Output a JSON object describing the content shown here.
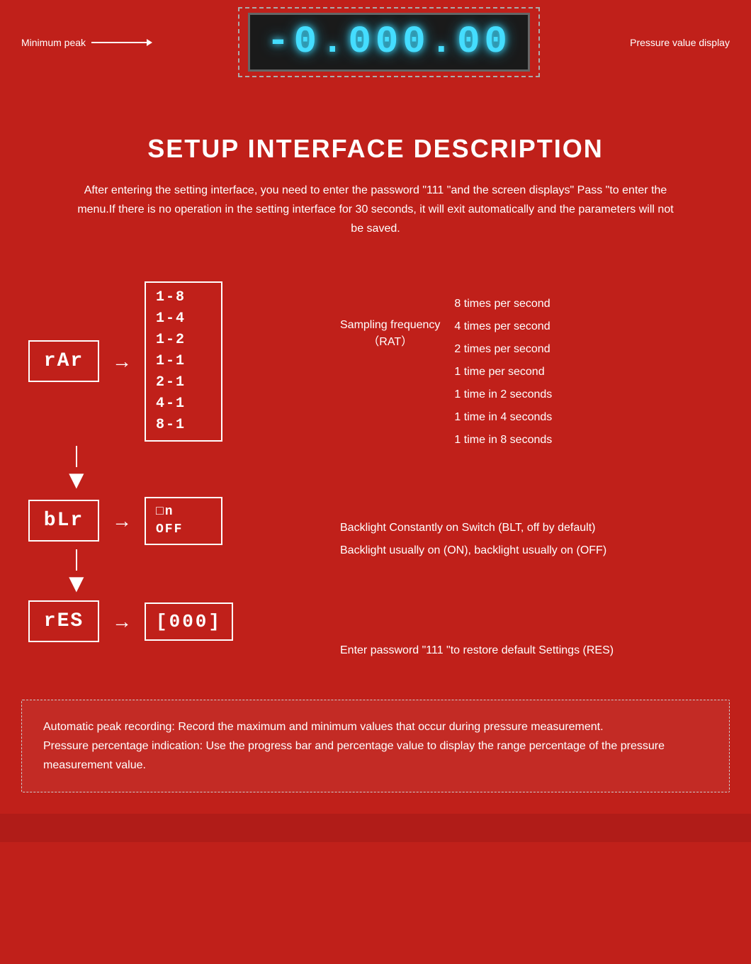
{
  "top": {
    "label_left": "Minimum peak",
    "label_right": "Pressure value display",
    "display_value": "-0.000.00",
    "display_text": "-0.000.00"
  },
  "setup": {
    "title": "SETUP INTERFACE DESCRIPTION",
    "description": "After entering the setting interface, you need to enter the password \"111 \"and the screen displays\" Pass \"to enter the menu.If there is no operation in the setting interface for 30 seconds, it will exit automatically and the parameters will not be saved."
  },
  "diagram": {
    "rat_label": "rAr",
    "rat_menu": [
      "1-8",
      "1-4",
      "1-2",
      "1-1",
      "2-1",
      "4-1",
      "8-1"
    ],
    "sampling_label": "Sampling frequency\n（RAT）",
    "freq_list": [
      "8 times per second",
      "4 times per second",
      "2 times per second",
      "1 time per second",
      "1 time in 2 seconds",
      "1 time in 4 seconds",
      "1 time in 8 seconds"
    ],
    "blt_label": "bLr",
    "blt_menu": [
      "on",
      "OFF"
    ],
    "blt_menu_item1": "on",
    "blt_menu_item2": "OFF",
    "blt_info1": "Backlight Constantly on Switch (BLT, off by default)",
    "blt_info2": "Backlight usually on (ON), backlight usually on (OFF)",
    "res_label": "rES",
    "res_value": "[000]",
    "res_info": "Enter password \"111 \"to restore default Settings (RES)"
  },
  "note": {
    "text1": "Automatic peak recording: Record the maximum and minimum values that occur during pressure measurement.",
    "text2": "Pressure percentage indication: Use the progress bar and percentage value to display the range percentage of the pressure measurement value."
  }
}
